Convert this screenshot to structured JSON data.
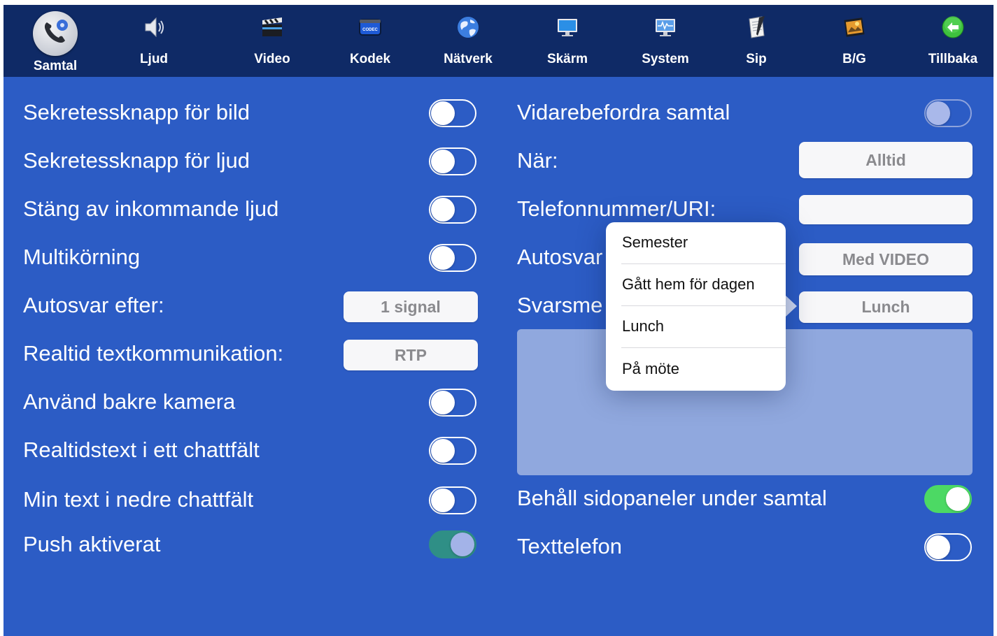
{
  "toolbar": {
    "tabs": [
      {
        "label": "Samtal",
        "icon": "phone-settings-icon",
        "active": true
      },
      {
        "label": "Ljud",
        "icon": "speaker-icon"
      },
      {
        "label": "Video",
        "icon": "clapperboard-icon"
      },
      {
        "label": "Kodek",
        "icon": "codec-chip-icon",
        "icon_text": "CODEC"
      },
      {
        "label": "Nätverk",
        "icon": "globe-icon"
      },
      {
        "label": "Skärm",
        "icon": "monitor-icon"
      },
      {
        "label": "System",
        "icon": "system-monitor-icon"
      },
      {
        "label": "Sip",
        "icon": "notepad-icon"
      },
      {
        "label": "B/G",
        "icon": "picture-icon"
      },
      {
        "label": "Tillbaka",
        "icon": "back-arrow-icon"
      }
    ]
  },
  "left": {
    "video_privacy": {
      "label": "Sekretessknapp för bild",
      "on": false
    },
    "audio_privacy": {
      "label": "Sekretessknapp för ljud",
      "on": false
    },
    "mute_incoming": {
      "label": "Stäng av inkommande ljud",
      "on": false
    },
    "multitasking": {
      "label": "Multikörning",
      "on": false
    },
    "autoanswer_after": {
      "label": "Autosvar efter:",
      "value": "1 signal"
    },
    "rtt": {
      "label": "Realtid textkommunikation:",
      "value": "RTP"
    },
    "rear_camera": {
      "label": "Använd bakre kamera",
      "on": false
    },
    "rtt_single_field": {
      "label": "Realtidstext i ett chattfält",
      "on": false
    },
    "my_text_lower": {
      "label": "Min text i nedre chattfält",
      "on": false
    },
    "push": {
      "label": "Push aktiverat",
      "on": true
    }
  },
  "right": {
    "forward_calls": {
      "label": "Vidarebefordra samtal",
      "on": false
    },
    "when": {
      "label": "När:",
      "value": "Alltid"
    },
    "phone_uri": {
      "label": "Telefonnummer/URI:",
      "value": ""
    },
    "autoanswer": {
      "label": "Autosvar",
      "value": "Med VIDEO"
    },
    "reply_message": {
      "label": "Svarsme",
      "value": "Lunch"
    },
    "keep_side_panels": {
      "label": "Behåll sidopaneler under samtal",
      "on": true
    },
    "text_telephone": {
      "label": "Texttelefon",
      "on": false
    }
  },
  "popover": {
    "items": [
      "Semester",
      "Gått hem för dagen",
      "Lunch",
      "På möte"
    ]
  },
  "colors": {
    "background": "#2c5cc5",
    "toolbar": "#0f2a66",
    "toggle_on_green": "#4cd964",
    "toggle_on_teal": "#2f8f86"
  }
}
